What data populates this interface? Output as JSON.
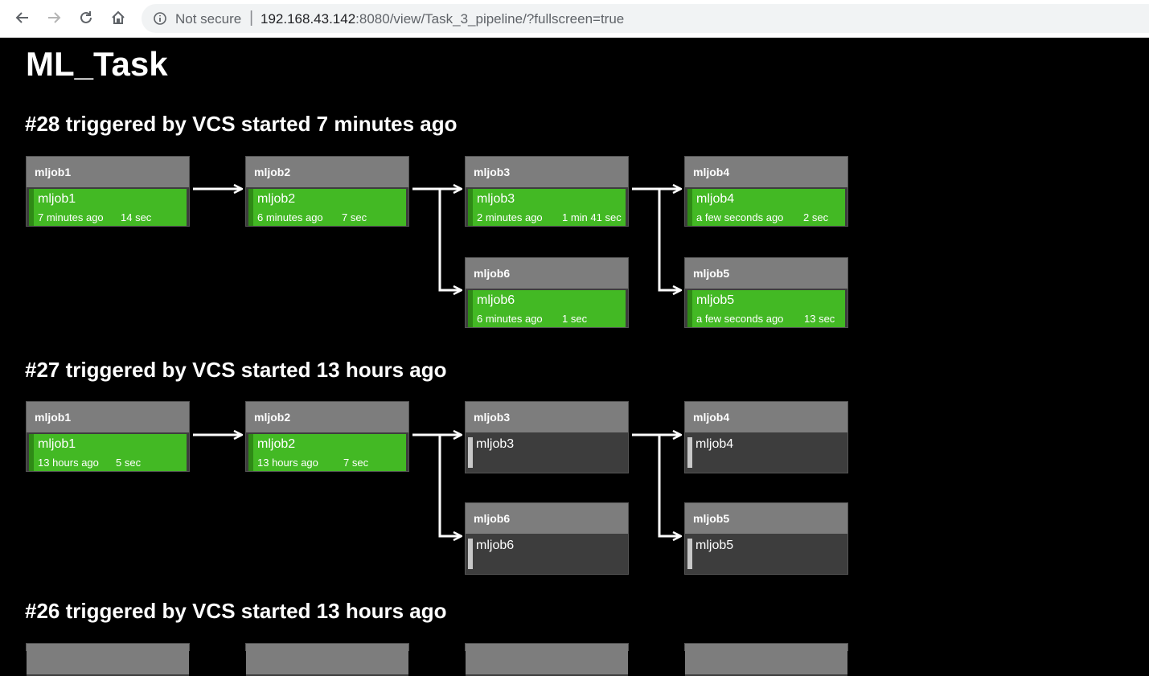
{
  "browser": {
    "security_label": "Not secure",
    "url_host": "192.168.43.142",
    "url_path": ":8080/view/Task_3_pipeline/?fullscreen=true"
  },
  "page": {
    "title": "ML_Task"
  },
  "runs": [
    {
      "heading": "#28 triggered by VCS started 7 minutes ago",
      "stages": [
        {
          "head": "mljob1",
          "name": "mljob1",
          "ago": "7 minutes ago",
          "dur": "14 sec",
          "status": "success"
        },
        {
          "head": "mljob2",
          "name": "mljob2",
          "ago": "6 minutes ago",
          "dur": "7 sec",
          "status": "success"
        },
        {
          "head": "mljob3",
          "name": "mljob3",
          "ago": "2 minutes ago",
          "dur": "1 min 41 sec",
          "status": "success"
        },
        {
          "head": "mljob4",
          "name": "mljob4",
          "ago": "a few seconds ago",
          "dur": "2 sec",
          "status": "success"
        },
        {
          "head": "mljob6",
          "name": "mljob6",
          "ago": "6 minutes ago",
          "dur": "1 sec",
          "status": "success"
        },
        {
          "head": "mljob5",
          "name": "mljob5",
          "ago": "a few seconds ago",
          "dur": "13 sec",
          "status": "success"
        }
      ]
    },
    {
      "heading": "#27 triggered by VCS started 13 hours ago",
      "stages": [
        {
          "head": "mljob1",
          "name": "mljob1",
          "ago": "13 hours ago",
          "dur": "5 sec",
          "status": "success"
        },
        {
          "head": "mljob2",
          "name": "mljob2",
          "ago": "13 hours ago",
          "dur": "7 sec",
          "status": "success"
        },
        {
          "head": "mljob3",
          "name": "mljob3",
          "status": "pending"
        },
        {
          "head": "mljob4",
          "name": "mljob4",
          "status": "pending"
        },
        {
          "head": "mljob6",
          "name": "mljob6",
          "status": "pending"
        },
        {
          "head": "mljob5",
          "name": "mljob5",
          "status": "pending"
        }
      ]
    },
    {
      "heading": "#26 triggered by VCS started 13 hours ago"
    }
  ],
  "colors": {
    "success": "#43b924",
    "header": "#7d7d7d",
    "pending": "#3d3d3d",
    "background": "#000000"
  },
  "icons": [
    "back-arrow-icon",
    "forward-arrow-icon",
    "reload-icon",
    "home-icon",
    "info-icon"
  ]
}
